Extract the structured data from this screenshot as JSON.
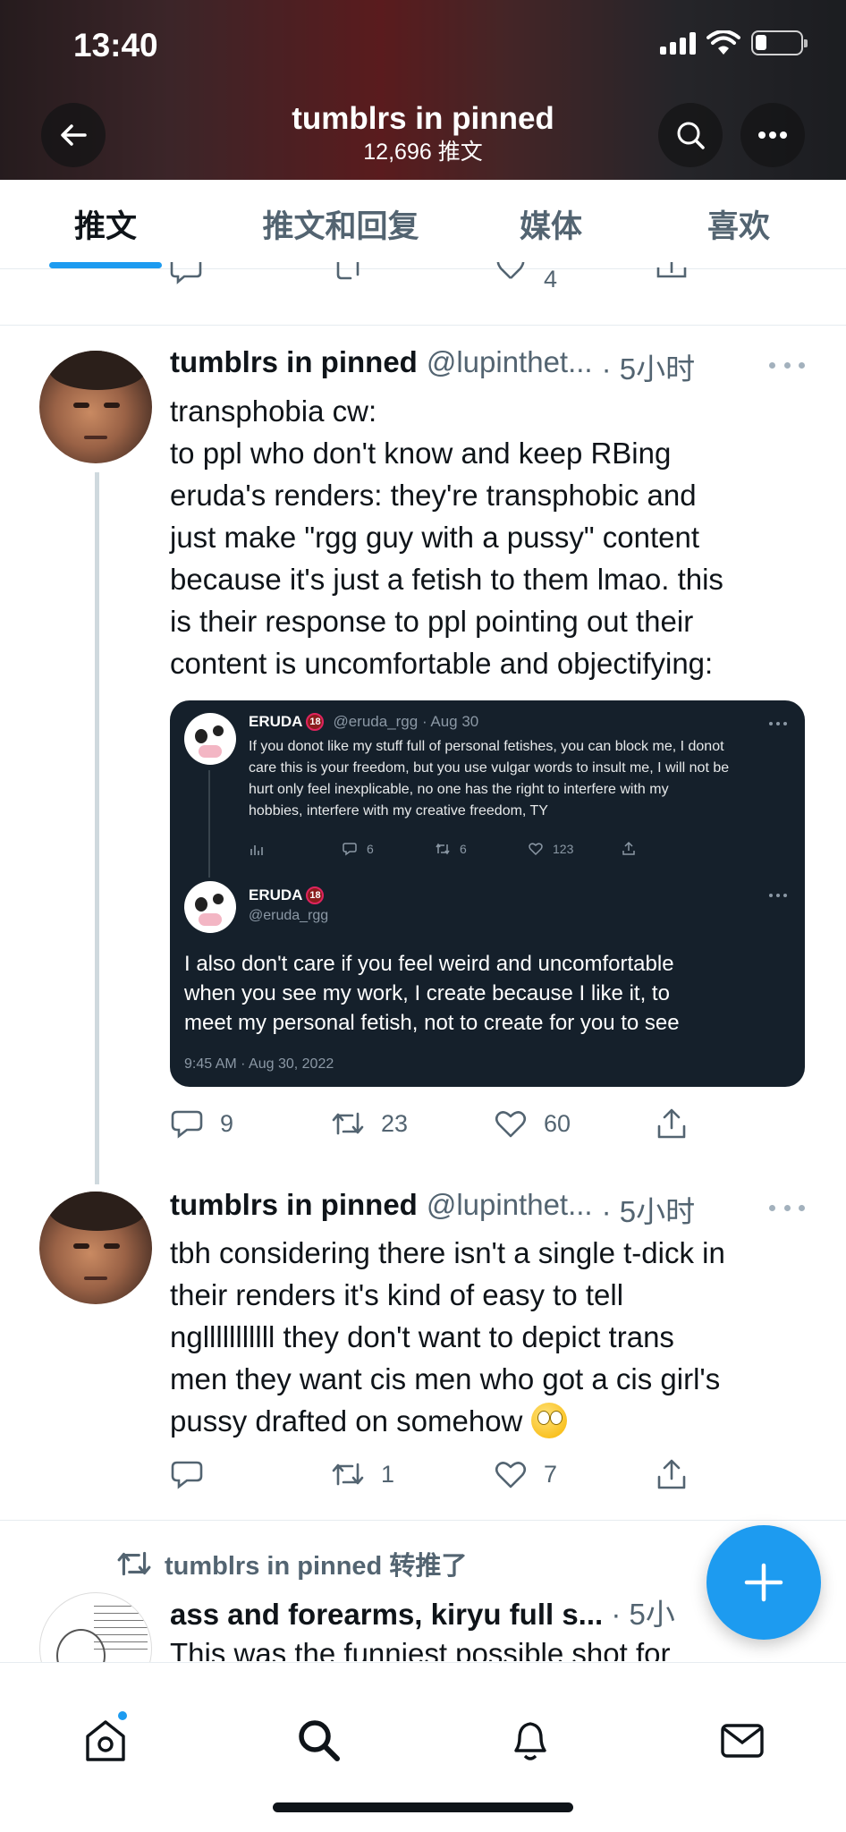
{
  "status_bar": {
    "time": "13:40"
  },
  "header": {
    "title": "tumblrs in pinned",
    "subtitle": "12,696 推文"
  },
  "tabs": [
    {
      "label": "推文",
      "active": true
    },
    {
      "label": "推文和回复",
      "active": false
    },
    {
      "label": "媒体",
      "active": false
    },
    {
      "label": "喜欢",
      "active": false
    }
  ],
  "prev_tweet": {
    "likes": "4"
  },
  "tweet1": {
    "name": "tumblrs in pinned",
    "handle": "@lupinthet...",
    "time": "· 5小时",
    "lines": [
      "transphobia cw:",
      "to ppl who don't know and keep RBing",
      "eruda's renders: they're transphobic and",
      "just make \"rgg guy with a pussy\" content",
      "because it's just a fetish to them lmao. this",
      "is their response to ppl pointing out their",
      "content is uncomfortable and objectifying:"
    ],
    "embed": {
      "post1": {
        "name": "ERUDA",
        "badge": "18",
        "meta": "@eruda_rgg · Aug 30",
        "lines": [
          "If you donot like my stuff full of personal fetishes, you can block me, I donot",
          "care this is your freedom, but you use vulgar words to insult me, I will not be",
          "hurt only feel inexplicable, no one has the right to interfere with my",
          "hobbies, interfere with my creative freedom, TY"
        ],
        "replies": "6",
        "retweets": "6",
        "likes": "123"
      },
      "post2": {
        "name": "ERUDA",
        "badge": "18",
        "handle": "@eruda_rgg",
        "lines": [
          "I also don't care if you feel weird and uncomfortable",
          "when you see my work, I create because I like it, to",
          "meet my personal fetish, not to create for you to see"
        ],
        "timestamp": "9:45 AM · Aug 30, 2022"
      }
    },
    "replies": "9",
    "retweets": "23",
    "likes": "60"
  },
  "tweet2": {
    "name": "tumblrs in pinned",
    "handle": "@lupinthet...",
    "time": "· 5小时",
    "lines": [
      "tbh considering there isn't a single t-dick in",
      "their renders it's kind of easy to tell",
      "nglllllllllll they don't want to depict trans",
      "men they want cis men who got a cis girl's",
      "pussy drafted on somehow"
    ],
    "emoji": "face-with-rolling-eyes",
    "retweets": "1",
    "likes": "7"
  },
  "tweet3": {
    "retweet_label": "tumblrs in pinned 转推了",
    "title": "ass and forearms, kiryu full s...",
    "time": "· 5小",
    "body": "This was the funniest possible shot for"
  },
  "colors": {
    "accent": "#1d9bf0",
    "text": "#0f1419",
    "muted": "#536471",
    "embed_bg": "#15202b"
  }
}
